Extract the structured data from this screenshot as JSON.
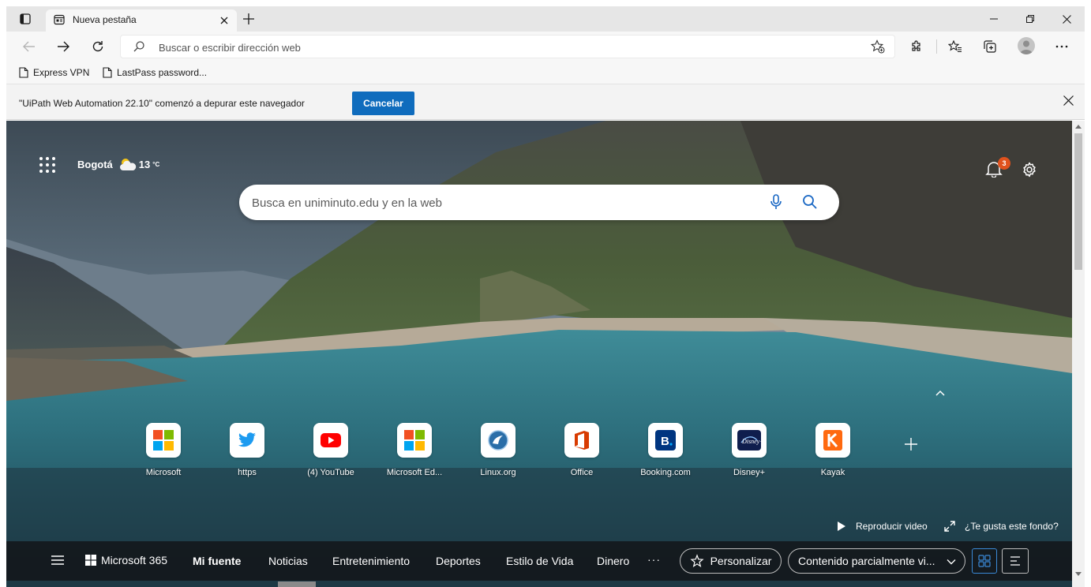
{
  "browser": {
    "tab": {
      "title": "Nueva pestaña"
    }
  },
  "address": {
    "placeholder": "Buscar o escribir dirección web"
  },
  "favorites": [
    {
      "label": "Express VPN"
    },
    {
      "label": "LastPass password..."
    }
  ],
  "infobar": {
    "message": "\"UiPath Web Automation 22.10\" comenzó a depurar este navegador",
    "cancel_label": "Cancelar"
  },
  "newtab": {
    "location": "Bogotá",
    "temperature": "13",
    "temperature_unit": "°C",
    "notification_count": "3",
    "search_placeholder": "Busca en uniminuto.edu y en la web",
    "tiles": [
      {
        "label": "Microsoft",
        "icon": "microsoft-logo-icon"
      },
      {
        "label": "https",
        "icon": "twitter-bird-icon"
      },
      {
        "label": "(4) YouTube",
        "icon": "youtube-play-icon"
      },
      {
        "label": "Microsoft Ed...",
        "icon": "microsoft-logo-icon"
      },
      {
        "label": "Linux.org",
        "icon": "linux-org-icon"
      },
      {
        "label": "Office",
        "icon": "office-icon"
      },
      {
        "label": "Booking.com",
        "icon": "booking-icon"
      },
      {
        "label": "Disney+",
        "icon": "disney-plus-icon"
      },
      {
        "label": "Kayak",
        "icon": "kayak-icon"
      }
    ],
    "play_video": "Reproducir video",
    "like_background": "¿Te gusta este fondo?"
  },
  "bottomnav": {
    "ms365": "Microsoft 365",
    "links": [
      "Mi fuente",
      "Noticias",
      "Entretenimiento",
      "Deportes",
      "Estilo de Vida",
      "Dinero"
    ],
    "more": "···",
    "personalize": "Personalizar",
    "content_select": "Contenido parcialmente vi..."
  },
  "colors": {
    "accent": "#0f6cbd",
    "badge": "#e0521d",
    "nav_bg": "#14181c"
  }
}
